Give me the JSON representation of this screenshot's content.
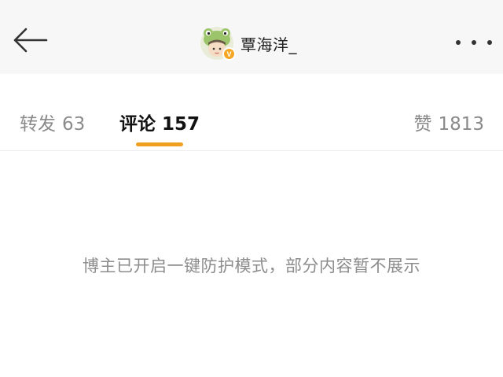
{
  "header": {
    "back_icon": "arrow-left-icon",
    "username": "覃海洋_",
    "avatar_icon": "frog-hat-avatar",
    "verified_badge": "V",
    "more_icon": "ellipsis-icon"
  },
  "tabs": [
    {
      "label": "转发",
      "count": "63",
      "active": false
    },
    {
      "label": "评论",
      "count": "157",
      "active": true
    },
    {
      "label": "赞",
      "count": "1813",
      "active": false
    }
  ],
  "colors": {
    "accent": "#f0a020",
    "verified": "#f5a623",
    "active_text": "#111111",
    "inactive_text": "#8a8a8a"
  },
  "notice": "博主已开启一键防护模式，部分内容暂不展示"
}
